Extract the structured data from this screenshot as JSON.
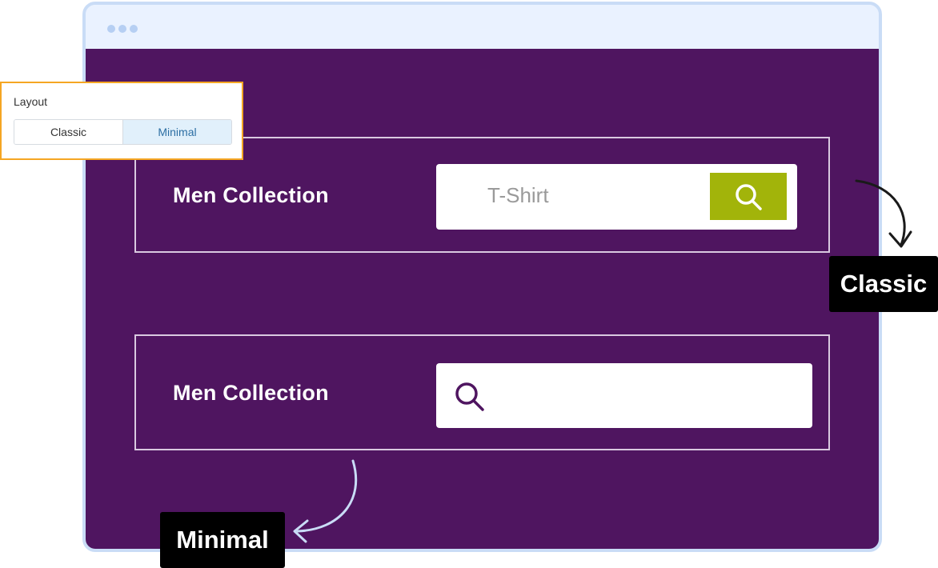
{
  "layout_setting": {
    "label": "Layout",
    "options": [
      "Classic",
      "Minimal"
    ],
    "selected": "Minimal"
  },
  "classic_panel": {
    "title": "Men Collection",
    "search_value": "T-Shirt",
    "button_icon": "search-icon"
  },
  "minimal_panel": {
    "title": "Men Collection",
    "search_icon": "search-icon"
  },
  "callouts": {
    "classic": "Classic",
    "minimal": "Minimal"
  },
  "colors": {
    "viewport_bg": "#4f1560",
    "classic_button": "#a2b40a",
    "highlight_border": "#f5a623",
    "selected_option_bg": "#e1f0fb"
  }
}
